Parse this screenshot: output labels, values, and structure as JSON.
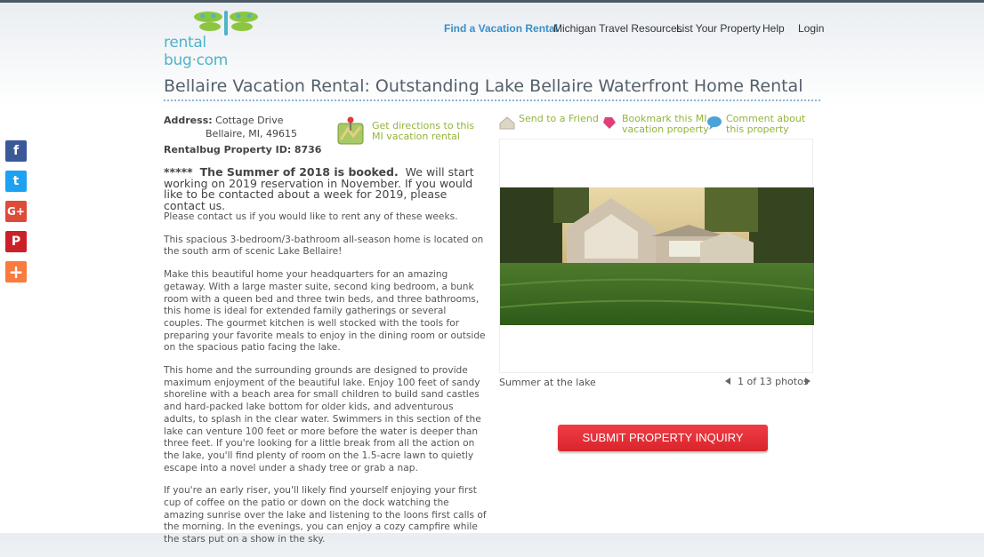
{
  "logo": {
    "brand_left": "rental bug",
    "dot": "·",
    "brand_right": "com"
  },
  "nav": {
    "items": [
      {
        "label": "Find a Vacation Rental",
        "active": true
      },
      {
        "label": "Michigan Travel Resources"
      },
      {
        "label": "List Your Property"
      },
      {
        "label": "Help"
      },
      {
        "label": "Login"
      }
    ]
  },
  "page": {
    "title": "Bellaire Vacation Rental: Outstanding Lake Bellaire Waterfront Home Rental"
  },
  "social": {
    "facebook": "f",
    "twitter": "t",
    "googleplus": "G+",
    "pinterest": "P",
    "more": "+"
  },
  "property": {
    "address_label": "Address:",
    "address_line1": "Cottage Drive",
    "address_line2": "Bellaire, MI, 49615",
    "id_label": "Rentalbug Property ID:",
    "id_value": "8736",
    "directions": "Get directions to this MI vacation rental"
  },
  "description": {
    "notice_stars": "*****",
    "notice_bold": "The Summer of 2018 is booked.",
    "notice_rest": "We will start working on 2019 reservation in November.  If you would like to be contacted about a week for 2019, please contact us.",
    "notice_small": "Please contact us if you would like to rent any of these weeks.",
    "p1": "This spacious 3-bedroom/3-bathroom all-season home is located on the south arm of scenic Lake Bellaire!",
    "p2": "Make this beautiful home your headquarters for an amazing getaway. With a large master suite, second king bedroom, a bunk room with a queen bed and three twin beds, and three bathrooms, this home is ideal for extended family gatherings or several couples.  The gourmet kitchen is well stocked with the tools for preparing your favorite meals to enjoy in the dining room or outside on the spacious patio facing the lake.",
    "p3": "This home and the surrounding grounds are designed to provide maximum enjoyment of the beautiful lake.  Enjoy 100 feet of sandy shoreline with a beach area for small children to build sand castles and hard-packed lake bottom for older kids, and adventurous adults, to splash in the clear water.  Swimmers in this section of the lake can venture 100 feet or more before the water is deeper than three feet.  If you're looking for a little break from all the action on the lake, you'll find plenty of room on the 1.5-acre lawn to quietly escape into a novel under a shady tree or grab a nap.",
    "p4": "If you're an early riser, you'll likely find yourself enjoying your first cup of coffee on the patio or down on the dock watching the amazing sunrise over the lake and listening to the loons first calls of the morning.  In the evenings, you can enjoy a cozy campfire while the stars put on a show in the sky."
  },
  "actions": {
    "send_friend": "Send to a Friend",
    "bookmark_line1": "Bookmark this MI",
    "bookmark_line2": "vacation property",
    "comment_line1": "Comment about",
    "comment_line2": "this property"
  },
  "gallery": {
    "caption": "Summer at the lake",
    "counter": "1 of 13 photos"
  },
  "inquiry": {
    "submit_label": "SUBMIT PROPERTY INQUIRY"
  },
  "colors": {
    "accent_green": "#93b53a",
    "nav_active": "#3a8fc8",
    "submit_red": "#e0282f"
  }
}
